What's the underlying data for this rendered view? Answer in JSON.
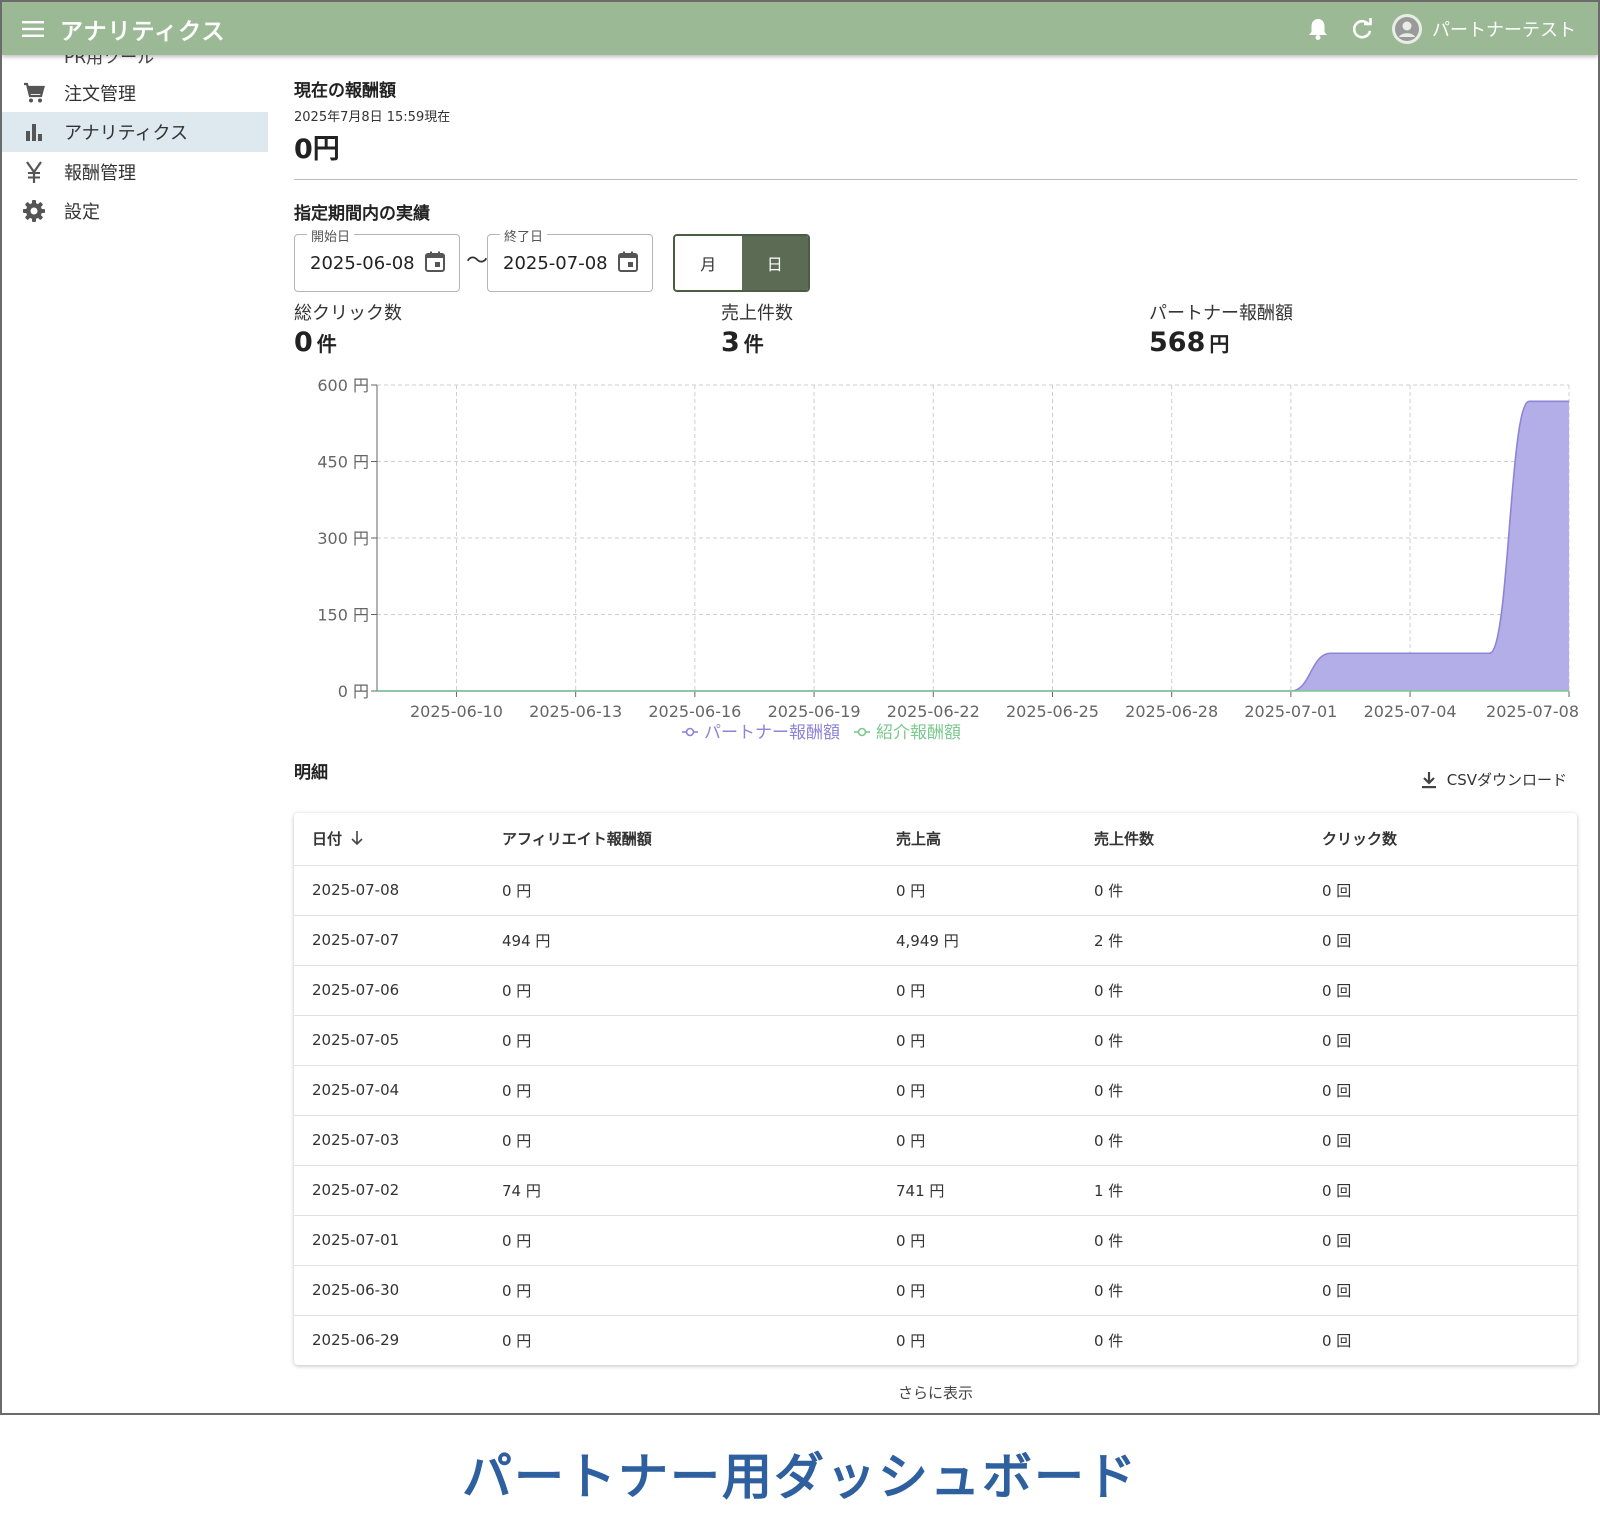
{
  "appbar": {
    "title": "アナリティクス",
    "username": "パートナーテスト"
  },
  "sidebar": {
    "partial_item": "PR用ツール",
    "items": [
      {
        "label": "注文管理",
        "icon": "cart-icon"
      },
      {
        "label": "アナリティクス",
        "icon": "bar-chart-icon",
        "active": true
      },
      {
        "label": "報酬管理",
        "icon": "yen-icon"
      },
      {
        "label": "設定",
        "icon": "gear-icon"
      }
    ]
  },
  "current": {
    "heading": "現在の報酬額",
    "asof": "2025年7月8日 15:59現在",
    "amount": "0円"
  },
  "period": {
    "heading": "指定期間内の実績",
    "start_label": "開始日",
    "start_value": "2025-06-08",
    "end_label": "終了日",
    "end_value": "2025-07-08",
    "tilde": "〜",
    "toggle_month": "月",
    "toggle_day": "日"
  },
  "stats": {
    "clicks_label": "総クリック数",
    "clicks_value": "0",
    "clicks_unit": "件",
    "sales_label": "売上件数",
    "sales_value": "3",
    "sales_unit": "件",
    "reward_label": "パートナー報酬額",
    "reward_value": "568",
    "reward_unit": "円"
  },
  "chart_data": {
    "type": "area",
    "x": [
      "2025-06-08",
      "2025-06-09",
      "2025-06-10",
      "2025-06-11",
      "2025-06-12",
      "2025-06-13",
      "2025-06-14",
      "2025-06-15",
      "2025-06-16",
      "2025-06-17",
      "2025-06-18",
      "2025-06-19",
      "2025-06-20",
      "2025-06-21",
      "2025-06-22",
      "2025-06-23",
      "2025-06-24",
      "2025-06-25",
      "2025-06-26",
      "2025-06-27",
      "2025-06-28",
      "2025-06-29",
      "2025-06-30",
      "2025-07-01",
      "2025-07-02",
      "2025-07-03",
      "2025-07-04",
      "2025-07-05",
      "2025-07-06",
      "2025-07-07",
      "2025-07-08"
    ],
    "x_ticks": [
      "2025-06-10",
      "2025-06-13",
      "2025-06-16",
      "2025-06-19",
      "2025-06-22",
      "2025-06-25",
      "2025-06-28",
      "2025-07-01",
      "2025-07-04",
      "2025-07-08"
    ],
    "y_ticks": [
      "600 円",
      "450 円",
      "300 円",
      "150 円",
      "0 円"
    ],
    "ylim": [
      0,
      600
    ],
    "grid": true,
    "legend_position": "bottom",
    "series": [
      {
        "name": "パートナー報酬額",
        "color": "#8c84d6",
        "fill": "#b3aee8",
        "values": [
          0,
          0,
          0,
          0,
          0,
          0,
          0,
          0,
          0,
          0,
          0,
          0,
          0,
          0,
          0,
          0,
          0,
          0,
          0,
          0,
          0,
          0,
          0,
          0,
          74,
          74,
          74,
          74,
          74,
          568,
          568
        ]
      },
      {
        "name": "紹介報酬額",
        "color": "#7cc98f",
        "values": [
          0,
          0,
          0,
          0,
          0,
          0,
          0,
          0,
          0,
          0,
          0,
          0,
          0,
          0,
          0,
          0,
          0,
          0,
          0,
          0,
          0,
          0,
          0,
          0,
          0,
          0,
          0,
          0,
          0,
          0,
          0
        ]
      }
    ]
  },
  "detail": {
    "heading": "明細",
    "csv_label": "CSVダウンロード",
    "columns": [
      "日付",
      "アフィリエイト報酬額",
      "売上高",
      "売上件数",
      "クリック数"
    ],
    "rows": [
      [
        "2025-07-08",
        "0 円",
        "0 円",
        "0 件",
        "0 回"
      ],
      [
        "2025-07-07",
        "494 円",
        "4,949 円",
        "2 件",
        "0 回"
      ],
      [
        "2025-07-06",
        "0 円",
        "0 円",
        "0 件",
        "0 回"
      ],
      [
        "2025-07-05",
        "0 円",
        "0 円",
        "0 件",
        "0 回"
      ],
      [
        "2025-07-04",
        "0 円",
        "0 円",
        "0 件",
        "0 回"
      ],
      [
        "2025-07-03",
        "0 円",
        "0 円",
        "0 件",
        "0 回"
      ],
      [
        "2025-07-02",
        "74 円",
        "741 円",
        "1 件",
        "0 回"
      ],
      [
        "2025-07-01",
        "0 円",
        "0 円",
        "0 件",
        "0 回"
      ],
      [
        "2025-06-30",
        "0 円",
        "0 円",
        "0 件",
        "0 回"
      ],
      [
        "2025-06-29",
        "0 円",
        "0 円",
        "0 件",
        "0 回"
      ]
    ],
    "more_label": "さらに表示"
  },
  "caption": "パートナー用ダッシュボード"
}
